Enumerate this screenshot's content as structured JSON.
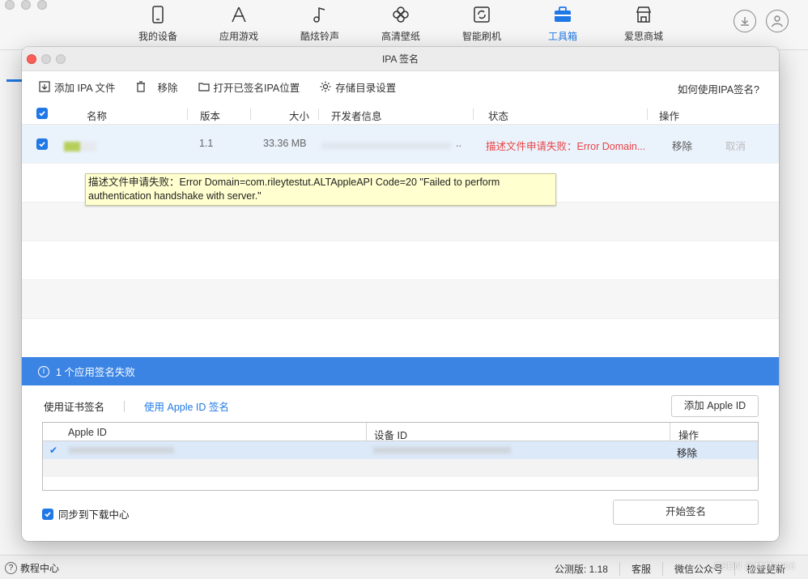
{
  "nav": {
    "items": [
      {
        "label": "我的设备",
        "icon": "phone-icon"
      },
      {
        "label": "应用游戏",
        "icon": "app-store-icon"
      },
      {
        "label": "酷炫铃声",
        "icon": "music-note-icon"
      },
      {
        "label": "高清壁纸",
        "icon": "flower-icon"
      },
      {
        "label": "智能刷机",
        "icon": "refresh-box-icon"
      },
      {
        "label": "工具箱",
        "icon": "toolbox-icon"
      },
      {
        "label": "爱思商城",
        "icon": "store-icon"
      }
    ],
    "active_index": 5,
    "accent": "#1f78e6"
  },
  "dialog": {
    "title": "IPA 签名",
    "toolbar": {
      "add": "添加 IPA 文件",
      "remove": "移除",
      "open_location": "打开已签名IPA位置",
      "storage_settings": "存储目录设置",
      "help": "如何使用IPA签名?"
    },
    "columns": {
      "name": "名称",
      "version": "版本",
      "size": "大小",
      "developer": "开发者信息",
      "status": "状态",
      "action": "操作"
    },
    "rows": [
      {
        "version": "1.1",
        "size": "33.36 MB",
        "developer_suffix": "..",
        "status": "描述文件申请失败：Error Domain...",
        "remove": "移除",
        "cancel": "取消"
      }
    ],
    "tooltip": "描述文件申请失败：Error Domain=com.rileytestut.ALTAppleAPI Code=20 \"Failed to perform authentication handshake with server.\"",
    "banner": "1 个应用签名失败",
    "tabs": {
      "cert": "使用证书签名",
      "apple_id": "使用 Apple ID 签名"
    },
    "add_apple_id": "添加 Apple ID",
    "id_table": {
      "col_apple_id": "Apple ID",
      "col_device_id": "设备 ID",
      "col_action": "操作",
      "row_remove": "移除"
    },
    "sync_label": "同步到下载中心",
    "start_button": "开始签名"
  },
  "statusbar": {
    "help": "教程中心",
    "version": "公测版: 1.18",
    "support": "客服",
    "wechat": "微信公众号",
    "update": "检查更新",
    "watermark": "CSDN @林林2006"
  }
}
